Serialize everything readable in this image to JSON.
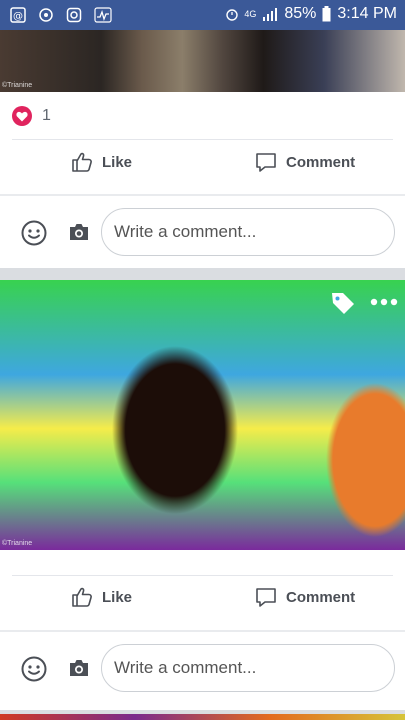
{
  "status_bar": {
    "battery_percent": "85%",
    "time": "3:14 PM",
    "left_icons": [
      "at-sign-icon",
      "sync-icon",
      "instagram-icon",
      "activity-icon"
    ],
    "right_icons": [
      "alarm-icon",
      "4g-icon",
      "signal-icon",
      "battery-icon"
    ]
  },
  "posts": [
    {
      "photo_watermark": "©Trianine",
      "reaction_count": "1",
      "like_label": "Like",
      "comment_label": "Comment",
      "comment_placeholder": "Write a comment..."
    },
    {
      "photo_watermark": "©Trianine",
      "like_label": "Like",
      "comment_label": "Comment",
      "comment_placeholder": "Write a comment..."
    }
  ],
  "colors": {
    "header_blue": "#3b5998",
    "heart_red": "#e0245e",
    "text_gray": "#4b4f56"
  }
}
